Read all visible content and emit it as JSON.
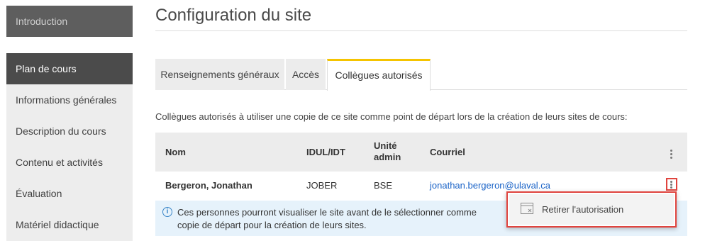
{
  "sidebar": {
    "intro": "Introduction",
    "items": [
      {
        "label": "Plan de cours"
      },
      {
        "label": "Informations générales"
      },
      {
        "label": "Description du cours"
      },
      {
        "label": "Contenu et activités"
      },
      {
        "label": "Évaluation"
      },
      {
        "label": "Matériel didactique"
      }
    ]
  },
  "page": {
    "title": "Configuration du site"
  },
  "tabs": [
    {
      "label": "Renseignements généraux"
    },
    {
      "label": "Accès"
    },
    {
      "label": "Collègues autorisés"
    }
  ],
  "description": "Collègues autorisés à utiliser une copie de ce site comme point de départ lors de la création de leurs sites de cours:",
  "table": {
    "headers": {
      "nom": "Nom",
      "idul": "IDUL/IDT",
      "unite_line1": "Unité",
      "unite_line2": "admin",
      "courriel": "Courriel"
    },
    "rows": [
      {
        "nom": "Bergeron, Jonathan",
        "idul": "JOBER",
        "unite": "BSE",
        "courriel": "jonathan.bergeron@ulaval.ca"
      }
    ]
  },
  "info": {
    "text": "Ces personnes pourront visualiser le site avant de le sélectionner comme copie de départ pour la création de leurs sites."
  },
  "context_menu": {
    "item_label": "Retirer l'autorisation"
  },
  "colors": {
    "accent_tab": "#f5c400",
    "highlight": "#e0443e",
    "link": "#1a63c7",
    "info_bg": "#e6f2fb"
  }
}
